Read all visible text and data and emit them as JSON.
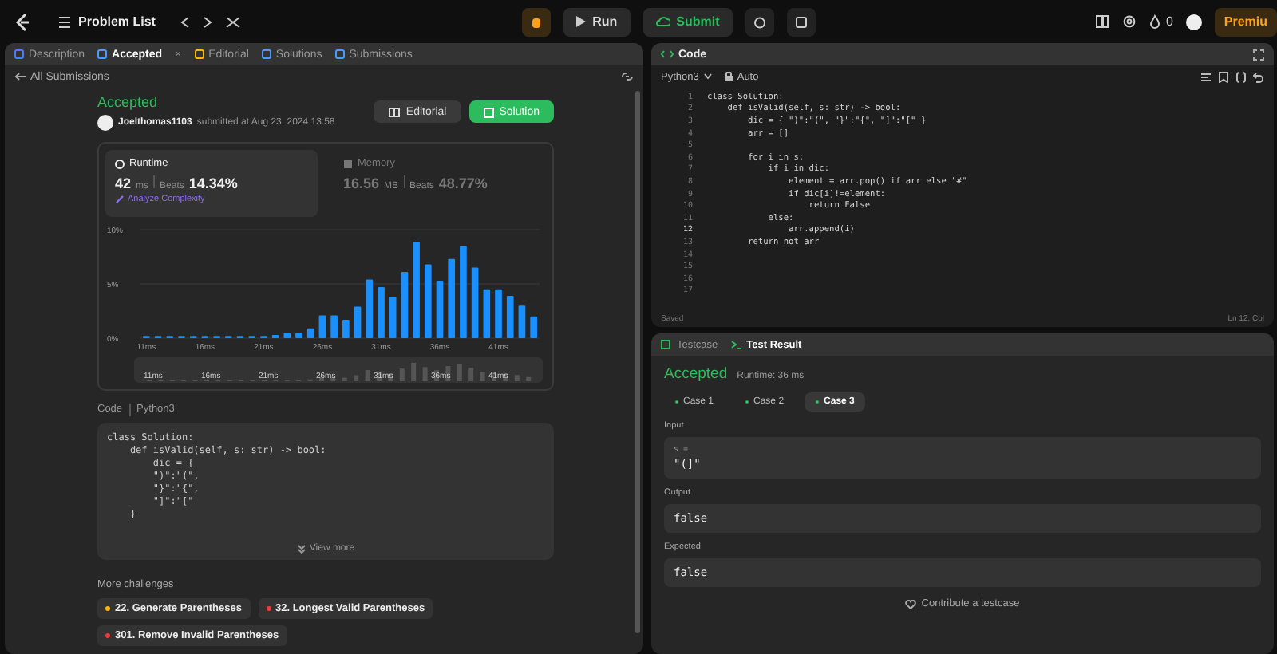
{
  "top_bar": {
    "title": "Problem List",
    "run": "Run",
    "submit": "Submit",
    "streak": "0",
    "premium": "Premiu"
  },
  "left_tabs": [
    {
      "label": "Description",
      "selected": false
    },
    {
      "label": "Accepted",
      "selected": true,
      "close": "×"
    },
    {
      "label": "Editorial",
      "selected": false
    },
    {
      "label": "Solutions",
      "selected": false
    },
    {
      "label": "Submissions",
      "selected": false
    }
  ],
  "back_link": "All Submissions",
  "submission": {
    "status": "Accepted",
    "user": "Joelthomas1103",
    "submitted": "submitted at Aug 23, 2024 13:58",
    "buttons": [
      {
        "label": "Editorial",
        "kind": "secondary"
      },
      {
        "label": "Solution",
        "kind": "primary"
      }
    ]
  },
  "metrics": [
    {
      "title": "Runtime",
      "value": "42",
      "unit": "ms",
      "beats_label": "Beats",
      "beats": "14.34%",
      "link": "Analyze Complexity",
      "selected": true
    },
    {
      "title": "Memory",
      "value": "16.56",
      "unit": "MB",
      "beats_label": "Beats",
      "beats": "48.77%",
      "selected": false
    }
  ],
  "chart_data": {
    "type": "bar",
    "x": [
      11,
      12,
      13,
      14,
      15,
      16,
      17,
      18,
      19,
      20,
      21,
      22,
      23,
      24,
      25,
      26,
      27,
      28,
      29,
      30,
      31,
      32,
      33,
      34,
      35,
      36,
      37,
      38,
      39,
      40,
      41,
      42,
      43,
      44
    ],
    "xlim": [
      10.5,
      44.5
    ],
    "series": [
      {
        "color": "#1a90ff",
        "values": [
          0.2,
          0.2,
          0.2,
          0.2,
          0.2,
          0.2,
          0.2,
          0.2,
          0.2,
          0.2,
          0.2,
          0.3,
          0.5,
          0.5,
          0.9,
          2.1,
          2.1,
          1.7,
          2.9,
          5.4,
          4.7,
          3.8,
          6.1,
          8.9,
          6.8,
          5.3,
          7.3,
          8.5,
          6.5,
          4.5,
          4.5,
          3.9,
          3.0,
          2.0
        ]
      }
    ],
    "ylim": [
      0,
      10
    ],
    "yticks": [
      {
        "value": 0,
        "label": "0%"
      },
      {
        "value": 5,
        "label": "5%"
      },
      {
        "value": 10,
        "label": "10%"
      }
    ],
    "xticks": [
      {
        "value": 11,
        "label": "11ms"
      },
      {
        "value": 16,
        "label": "16ms"
      },
      {
        "value": 21,
        "label": "21ms"
      },
      {
        "value": 26,
        "label": "26ms"
      },
      {
        "value": 31,
        "label": "31ms"
      },
      {
        "value": 36,
        "label": "36ms"
      },
      {
        "value": 41,
        "label": "41ms"
      }
    ]
  },
  "navigator_labels": [
    "11ms",
    "16ms",
    "21ms",
    "26ms",
    "31ms",
    "36ms",
    "41ms"
  ],
  "code_section": {
    "label": "Code",
    "language": "Python3",
    "view_more": "View more",
    "lines": [
      "class Solution:",
      "    def isValid(self, s: str) -> bool:",
      "        dic = {",
      "        \")\":\"(\",",
      "        \"}\":\"{\",",
      "        \"]\":\"[\"",
      "    }"
    ]
  },
  "more_challenges": {
    "title": "More challenges",
    "items": [
      {
        "label": "22. Generate Parentheses",
        "color": "#ffb800"
      },
      {
        "label": "32. Longest Valid Parentheses",
        "color": "#f63737"
      },
      {
        "label": "301. Remove Invalid Parentheses",
        "color": "#f63737"
      }
    ]
  },
  "editor": {
    "title": "Code",
    "language": "Python3",
    "mode": "Auto",
    "status": "Saved",
    "position": "Ln 12, Col",
    "lines": [
      {
        "n": "1",
        "code": "class Solution:"
      },
      {
        "n": "2",
        "code": "    def isValid(self, s: str) -> bool:"
      },
      {
        "n": "3",
        "code": "        dic = { \")\":\"(\", \"}\":\"{\", \"]\":\"[\" }"
      },
      {
        "n": "4",
        "code": "        arr = []"
      },
      {
        "n": "5"
      },
      {
        "n": "6",
        "code": "        for i in s:"
      },
      {
        "n": "7",
        "code": "            if i in dic:"
      },
      {
        "n": "8",
        "code": "                element = arr.pop() if arr else \"#\""
      },
      {
        "n": "9",
        "code": "                if dic[i]!=element:"
      },
      {
        "n": "10",
        "code": "                    return False"
      },
      {
        "n": "11",
        "code": "            else:"
      },
      {
        "n": "12",
        "code": "                arr.append(i)"
      },
      {
        "n": "13",
        "code": "        return not arr"
      },
      {
        "n": "14"
      },
      {
        "n": "15"
      },
      {
        "n": "16"
      },
      {
        "n": "17"
      }
    ]
  },
  "result_tabs": [
    {
      "label": "Testcase",
      "selected": false
    },
    {
      "label": "Test Result",
      "selected": true
    }
  ],
  "result": {
    "status": "Accepted",
    "runtime": "Runtime: 36 ms",
    "cases": [
      {
        "label": "Case 1",
        "selected": false
      },
      {
        "label": "Case 2",
        "selected": false
      },
      {
        "label": "Case 3",
        "selected": true
      }
    ],
    "fields": [
      {
        "label": "Input",
        "variable": "s =",
        "value": "\"(]\""
      },
      {
        "label": "Output",
        "value": "false"
      },
      {
        "label": "Expected",
        "value": "false"
      }
    ],
    "contribute": "Contribute a testcase"
  }
}
